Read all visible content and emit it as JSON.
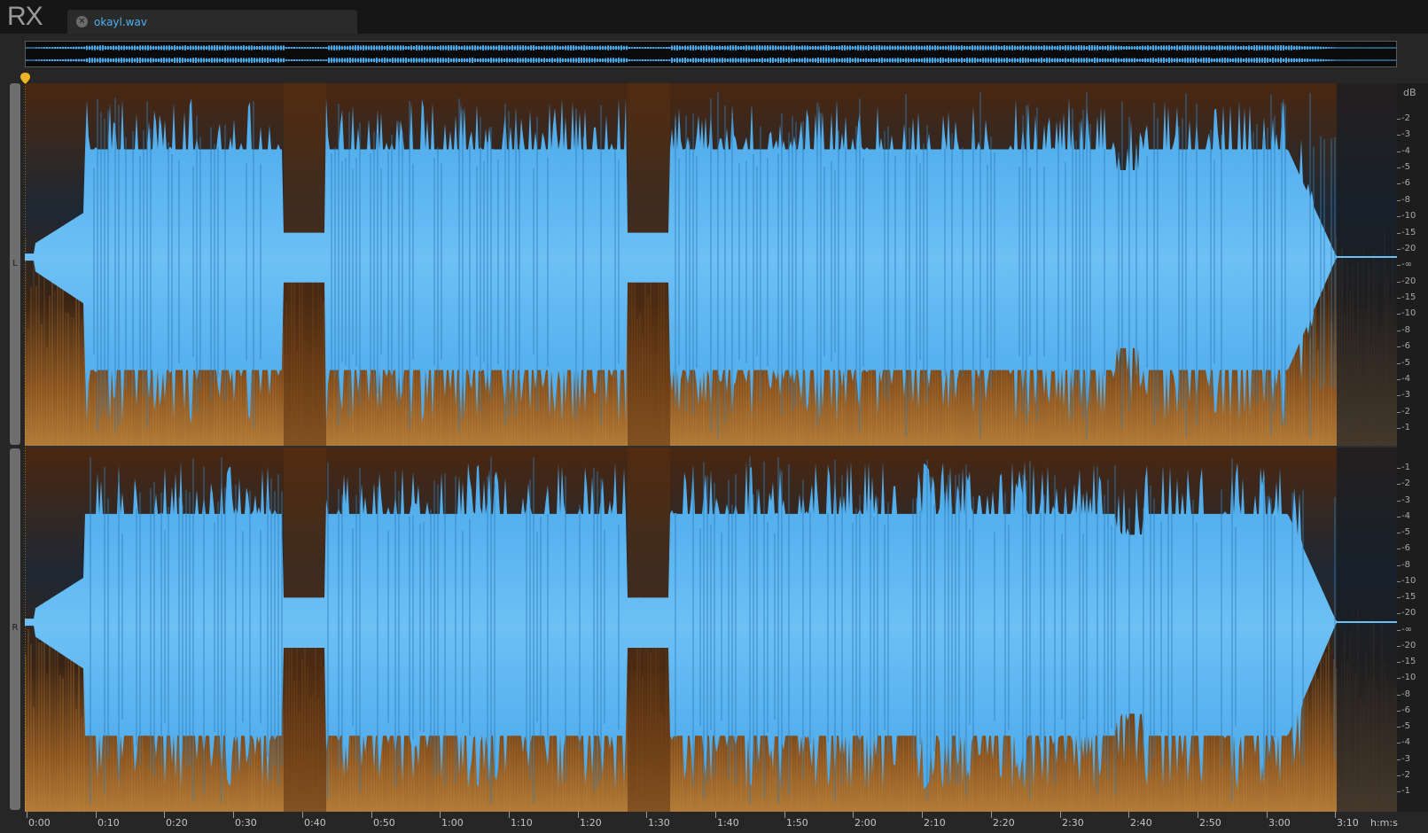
{
  "app": {
    "logo": "RX"
  },
  "tabs": [
    {
      "label": "okayl.wav",
      "active": true
    }
  ],
  "channels": [
    {
      "label": "L"
    },
    {
      "label": "R"
    }
  ],
  "db_scale": {
    "unit": "dB",
    "left": [
      "-2",
      "-3",
      "-4",
      "-5",
      "-6",
      "-8",
      "-10",
      "-15",
      "-20",
      "-∞",
      "-20",
      "-15",
      "-10",
      "-8",
      "-6",
      "-5",
      "-4",
      "-3",
      "-2",
      "-1"
    ],
    "right": [
      "-1",
      "-2",
      "-3",
      "-4",
      "-5",
      "-6",
      "-8",
      "-10",
      "-15",
      "-20",
      "-∞",
      "-20",
      "-15",
      "-10",
      "-8",
      "-6",
      "-5",
      "-4",
      "-3",
      "-2",
      "-1"
    ]
  },
  "timeline": {
    "unit": "h:m:s",
    "labels": [
      "0:00",
      "0:10",
      "0:20",
      "0:30",
      "0:40",
      "0:50",
      "1:00",
      "1:10",
      "1:20",
      "1:30",
      "1:40",
      "1:50",
      "2:00",
      "2:10",
      "2:20",
      "2:30",
      "2:40",
      "2:50",
      "3:00",
      "3:10"
    ]
  },
  "colors": {
    "waveform": "#4aa8ea",
    "waveform_light": "#6cc0f5",
    "spectrogram_dark": "#1c2430",
    "spectrogram_mid": "#7a3f14",
    "spectrogram_hot": "#c98a3a",
    "accent": "#4fb0f0",
    "playhead": "#f0b429"
  }
}
